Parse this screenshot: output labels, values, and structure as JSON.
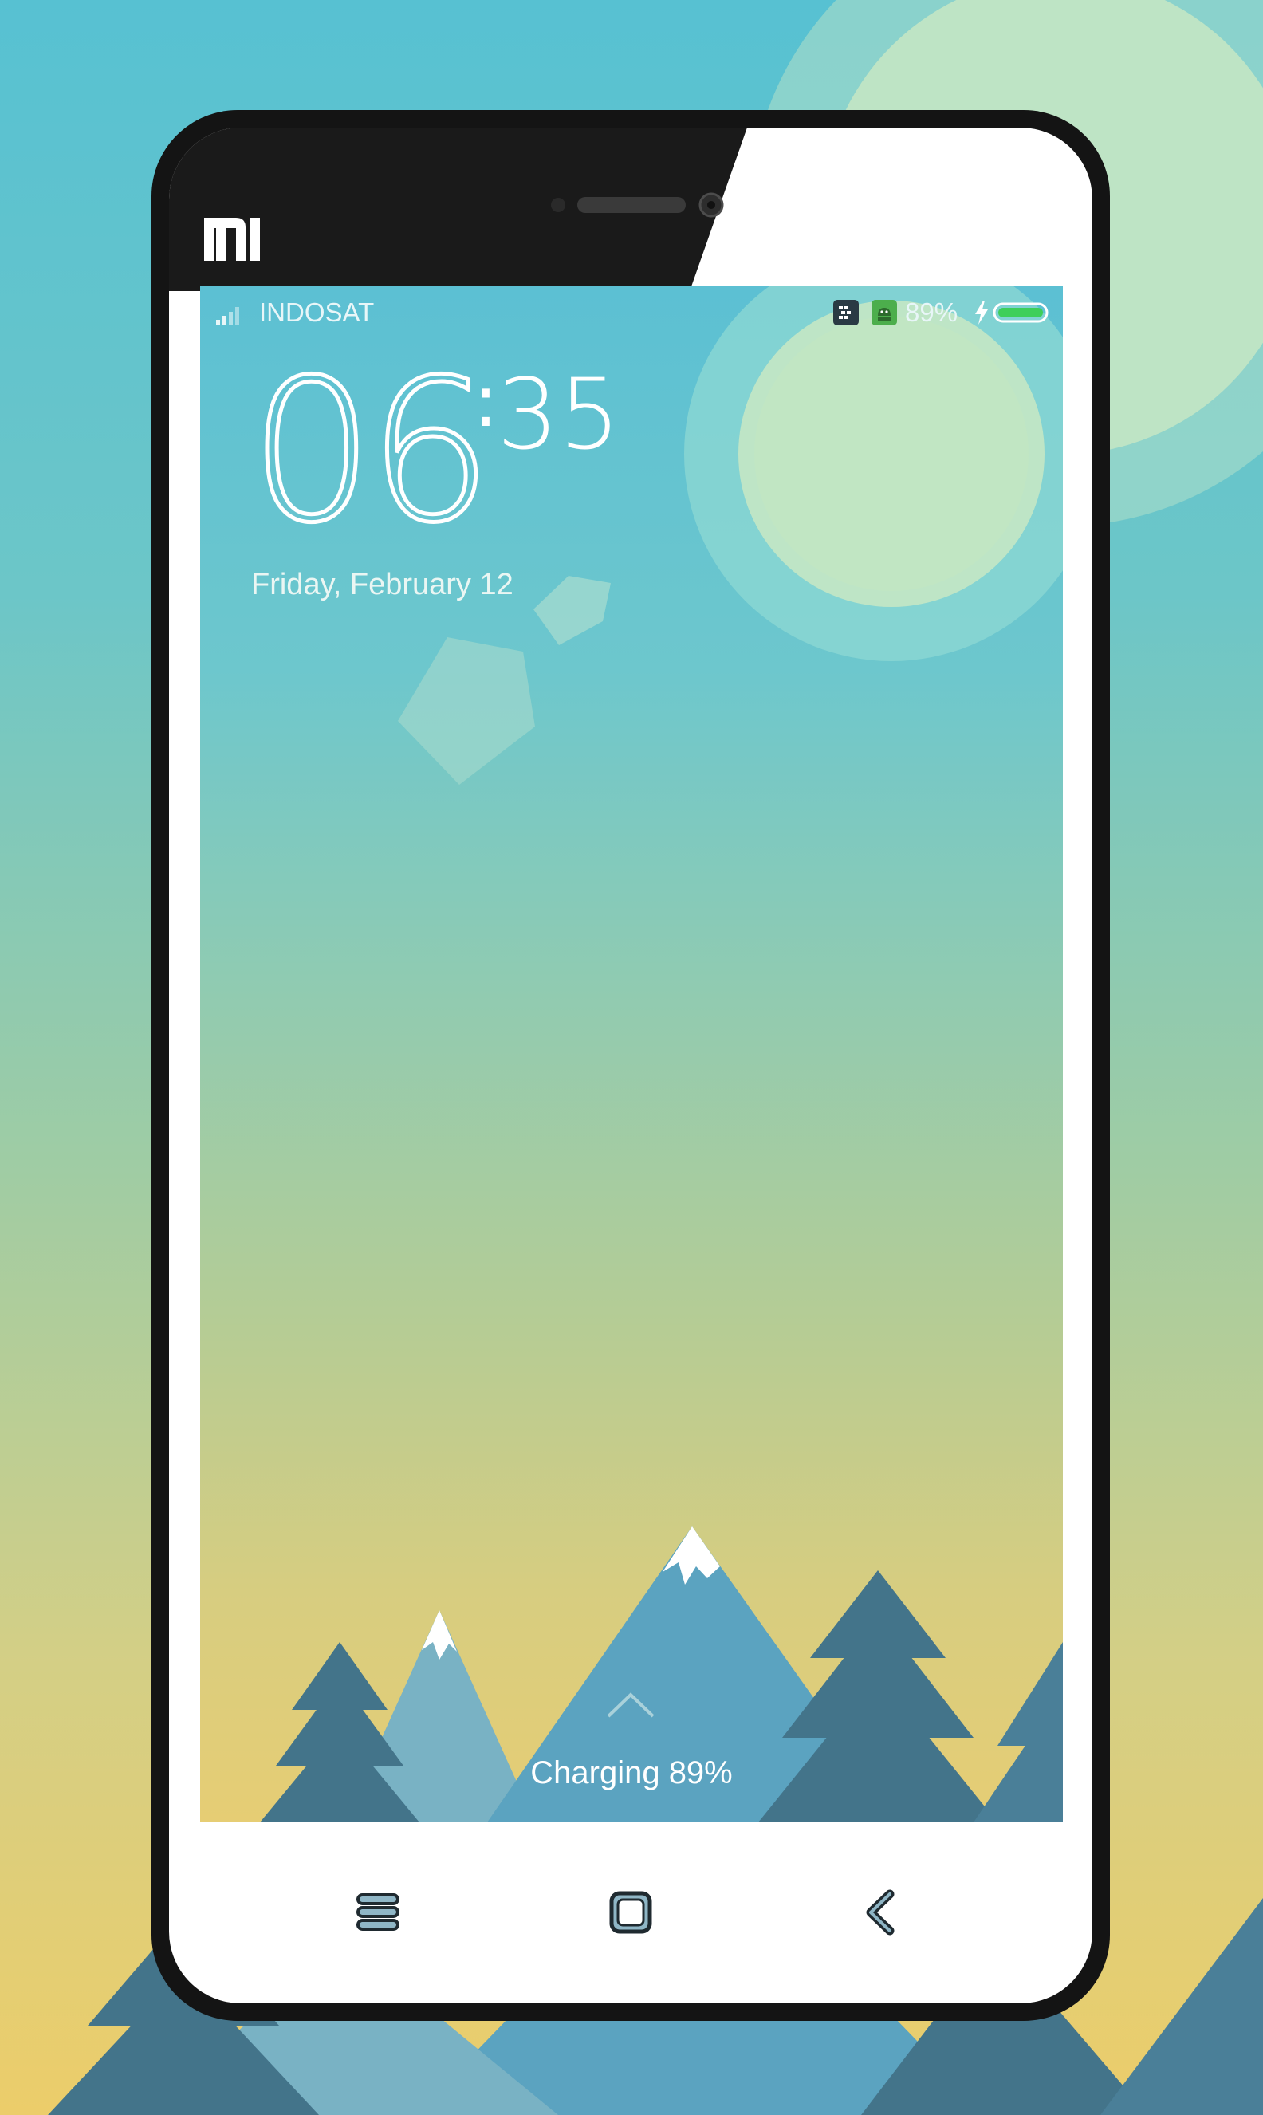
{
  "brand": {
    "logo_text": "MI"
  },
  "status_bar": {
    "carrier": "INDOSAT",
    "battery_percent": "89%",
    "icons": [
      "signal-icon",
      "bbm-icon",
      "android-icon",
      "charging-bolt-icon",
      "battery-icon"
    ]
  },
  "lockscreen": {
    "clock_hour": "06",
    "clock_separator": ":",
    "clock_minute": "35",
    "date": "Friday, February 12",
    "unlock_icon": "chevron-up-icon",
    "charging_text": "Charging 89%"
  },
  "nav_bar": {
    "buttons": [
      "menu-icon",
      "home-icon",
      "back-icon"
    ]
  },
  "colors": {
    "sky_top": "#57c1d2",
    "sky_bottom": "#eccd6a",
    "sun": "#c3e6c3",
    "mountain_light": "#79b2c4",
    "mountain_mid": "#5ba3c0",
    "tree_dark": "#43748a",
    "battery_green": "#3ecf5a"
  }
}
